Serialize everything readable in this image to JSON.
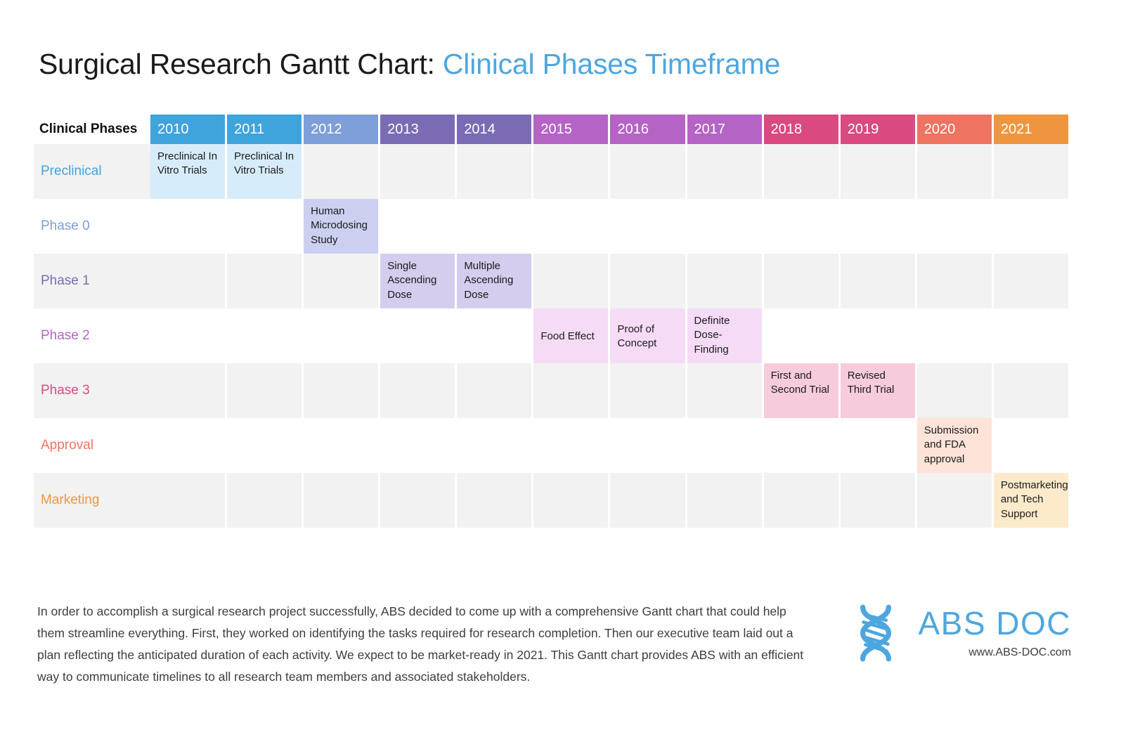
{
  "title": {
    "main": "Surgical Research Gantt Chart: ",
    "accent": "Clinical Phases Timeframe"
  },
  "header": {
    "row_label": "Clinical Phases",
    "years": [
      "2010",
      "2011",
      "2012",
      "2013",
      "2014",
      "2015",
      "2016",
      "2017",
      "2018",
      "2019",
      "2020",
      "2021"
    ],
    "year_colors": [
      "#3fa3dc",
      "#3fa3dc",
      "#7d9ed8",
      "#7b6bb5",
      "#7b6bb5",
      "#b563c4",
      "#b563c4",
      "#b563c4",
      "#d94a80",
      "#d94a80",
      "#ee7361",
      "#ef9540"
    ]
  },
  "rows": [
    {
      "label": "Preclinical",
      "label_color": "#3fa3dc",
      "shaded": true,
      "bar_color": "#d7ecfa"
    },
    {
      "label": "Phase 0",
      "label_color": "#7d9ed8",
      "shaded": false,
      "bar_color": "#ccd0f0"
    },
    {
      "label": "Phase 1",
      "label_color": "#7b6bb5",
      "shaded": true,
      "bar_color": "#d5cdee"
    },
    {
      "label": "Phase 2",
      "label_color": "#b563c4",
      "shaded": false,
      "bar_color": "#f6dbf7"
    },
    {
      "label": "Phase 3",
      "label_color": "#d94a80",
      "shaded": true,
      "bar_color": "#f6cbdb"
    },
    {
      "label": "Approval",
      "label_color": "#ee7361",
      "shaded": false,
      "bar_color": "#fde3d8"
    },
    {
      "label": "Marketing",
      "label_color": "#ef9540",
      "shaded": true,
      "bar_color": "#fdeacb"
    }
  ],
  "chart_data": {
    "type": "bar",
    "title": "Surgical Research Gantt Chart: Clinical Phases Timeframe",
    "xlabel": "",
    "ylabel": "Clinical Phases",
    "categories": [
      "2010",
      "2011",
      "2012",
      "2013",
      "2014",
      "2015",
      "2016",
      "2017",
      "2018",
      "2019",
      "2020",
      "2021"
    ],
    "series": [
      {
        "name": "Preclinical",
        "values": [
          1,
          1,
          0,
          0,
          0,
          0,
          0,
          0,
          0,
          0,
          0,
          0
        ]
      },
      {
        "name": "Phase 0",
        "values": [
          0,
          0,
          1,
          0,
          0,
          0,
          0,
          0,
          0,
          0,
          0,
          0
        ]
      },
      {
        "name": "Phase 1",
        "values": [
          0,
          0,
          0,
          1,
          1,
          0,
          0,
          0,
          0,
          0,
          0,
          0
        ]
      },
      {
        "name": "Phase 2",
        "values": [
          0,
          0,
          0,
          0,
          0,
          1,
          1,
          1,
          0,
          0,
          0,
          0
        ]
      },
      {
        "name": "Phase 3",
        "values": [
          0,
          0,
          0,
          0,
          0,
          0,
          0,
          0,
          1,
          1,
          0,
          0
        ]
      },
      {
        "name": "Approval",
        "values": [
          0,
          0,
          0,
          0,
          0,
          0,
          0,
          0,
          0,
          0,
          1,
          0
        ]
      },
      {
        "name": "Marketing",
        "values": [
          0,
          0,
          0,
          0,
          0,
          0,
          0,
          0,
          0,
          0,
          0,
          1
        ]
      }
    ],
    "tasks": [
      {
        "row": "Preclinical",
        "start_year": "2010",
        "end_year": "2010",
        "label": "Preclinical In Vitro Trials"
      },
      {
        "row": "Preclinical",
        "start_year": "2011",
        "end_year": "2011",
        "label": "Preclinical In Vitro Trials"
      },
      {
        "row": "Phase 0",
        "start_year": "2012",
        "end_year": "2012",
        "label": "Human Microdosing Study"
      },
      {
        "row": "Phase 1",
        "start_year": "2013",
        "end_year": "2013",
        "label": "Single Ascending Dose"
      },
      {
        "row": "Phase 1",
        "start_year": "2014",
        "end_year": "2014",
        "label": "Multiple Ascending Dose"
      },
      {
        "row": "Phase 2",
        "start_year": "2015",
        "end_year": "2015",
        "label": "Food Effect"
      },
      {
        "row": "Phase 2",
        "start_year": "2016",
        "end_year": "2016",
        "label": "Proof of Concept"
      },
      {
        "row": "Phase 2",
        "start_year": "2017",
        "end_year": "2017",
        "label": "Definite Dose-Finding"
      },
      {
        "row": "Phase 3",
        "start_year": "2018",
        "end_year": "2018",
        "label": "First and Second Trial"
      },
      {
        "row": "Phase 3",
        "start_year": "2019",
        "end_year": "2019",
        "label": "Revised Third Trial"
      },
      {
        "row": "Approval",
        "start_year": "2020",
        "end_year": "2020",
        "label": "Submission and FDA approval"
      },
      {
        "row": "Marketing",
        "start_year": "2021",
        "end_year": "2021",
        "label": "Postmarketing and Tech Support"
      }
    ]
  },
  "cells": [
    [
      {
        "text": "Preclinical In Vitro Trials",
        "filled": true,
        "valign": "top"
      },
      {
        "text": "Preclinical In Vitro Trials",
        "filled": true,
        "valign": "top"
      },
      {
        "text": "",
        "filled": false
      },
      {
        "text": "",
        "filled": false
      },
      {
        "text": "",
        "filled": false
      },
      {
        "text": "",
        "filled": false
      },
      {
        "text": "",
        "filled": false
      },
      {
        "text": "",
        "filled": false
      },
      {
        "text": "",
        "filled": false
      },
      {
        "text": "",
        "filled": false
      },
      {
        "text": "",
        "filled": false
      },
      {
        "text": "",
        "filled": false
      }
    ],
    [
      {
        "text": "",
        "filled": false
      },
      {
        "text": "",
        "filled": false
      },
      {
        "text": "Human Microdosing Study",
        "filled": true,
        "valign": "top"
      },
      {
        "text": "",
        "filled": false
      },
      {
        "text": "",
        "filled": false
      },
      {
        "text": "",
        "filled": false
      },
      {
        "text": "",
        "filled": false
      },
      {
        "text": "",
        "filled": false
      },
      {
        "text": "",
        "filled": false
      },
      {
        "text": "",
        "filled": false
      },
      {
        "text": "",
        "filled": false
      },
      {
        "text": "",
        "filled": false
      }
    ],
    [
      {
        "text": "",
        "filled": false
      },
      {
        "text": "",
        "filled": false
      },
      {
        "text": "",
        "filled": false
      },
      {
        "text": "Single Ascending Dose",
        "filled": true,
        "valign": "top"
      },
      {
        "text": "Multiple Ascending Dose",
        "filled": true,
        "valign": "top"
      },
      {
        "text": "",
        "filled": false
      },
      {
        "text": "",
        "filled": false
      },
      {
        "text": "",
        "filled": false
      },
      {
        "text": "",
        "filled": false
      },
      {
        "text": "",
        "filled": false
      },
      {
        "text": "",
        "filled": false
      },
      {
        "text": "",
        "filled": false
      }
    ],
    [
      {
        "text": "",
        "filled": false
      },
      {
        "text": "",
        "filled": false
      },
      {
        "text": "",
        "filled": false
      },
      {
        "text": "",
        "filled": false
      },
      {
        "text": "",
        "filled": false
      },
      {
        "text": "Food Effect",
        "filled": true,
        "valign": "center"
      },
      {
        "text": "Proof of Concept",
        "filled": true,
        "valign": "center"
      },
      {
        "text": "Definite Dose-Finding",
        "filled": true,
        "valign": "top"
      },
      {
        "text": "",
        "filled": false
      },
      {
        "text": "",
        "filled": false
      },
      {
        "text": "",
        "filled": false
      },
      {
        "text": "",
        "filled": false
      }
    ],
    [
      {
        "text": "",
        "filled": false
      },
      {
        "text": "",
        "filled": false
      },
      {
        "text": "",
        "filled": false
      },
      {
        "text": "",
        "filled": false
      },
      {
        "text": "",
        "filled": false
      },
      {
        "text": "",
        "filled": false
      },
      {
        "text": "",
        "filled": false
      },
      {
        "text": "",
        "filled": false
      },
      {
        "text": "First and Second Trial",
        "filled": true,
        "valign": "top"
      },
      {
        "text": "Revised Third Trial",
        "filled": true,
        "valign": "top"
      },
      {
        "text": "",
        "filled": false
      },
      {
        "text": "",
        "filled": false
      }
    ],
    [
      {
        "text": "",
        "filled": false
      },
      {
        "text": "",
        "filled": false
      },
      {
        "text": "",
        "filled": false
      },
      {
        "text": "",
        "filled": false
      },
      {
        "text": "",
        "filled": false
      },
      {
        "text": "",
        "filled": false
      },
      {
        "text": "",
        "filled": false
      },
      {
        "text": "",
        "filled": false
      },
      {
        "text": "",
        "filled": false
      },
      {
        "text": "",
        "filled": false
      },
      {
        "text": "Submission and FDA approval",
        "filled": true,
        "valign": "top"
      },
      {
        "text": "",
        "filled": false
      }
    ],
    [
      {
        "text": "",
        "filled": false
      },
      {
        "text": "",
        "filled": false
      },
      {
        "text": "",
        "filled": false
      },
      {
        "text": "",
        "filled": false
      },
      {
        "text": "",
        "filled": false
      },
      {
        "text": "",
        "filled": false
      },
      {
        "text": "",
        "filled": false
      },
      {
        "text": "",
        "filled": false
      },
      {
        "text": "",
        "filled": false
      },
      {
        "text": "",
        "filled": false
      },
      {
        "text": "",
        "filled": false
      },
      {
        "text": "Postmarketing and Tech Support",
        "filled": true,
        "valign": "top"
      }
    ]
  ],
  "footer": {
    "paragraph": "In order to accomplish a surgical research project successfully, ABS decided to come up with a comprehensive Gantt chart that could help them streamline everything. First, they worked on identifying the tasks required for research completion. Then our executive team laid out a plan reflecting the anticipated duration of each activity. We expect to be market-ready in 2021. This Gantt chart provides ABS with an efficient way to communicate timelines to all research team members and associated stakeholders."
  },
  "logo": {
    "name": "ABS DOC",
    "url": "www.ABS-DOC.com",
    "icon": "dna-helix-icon",
    "color": "#4ea6e0"
  }
}
